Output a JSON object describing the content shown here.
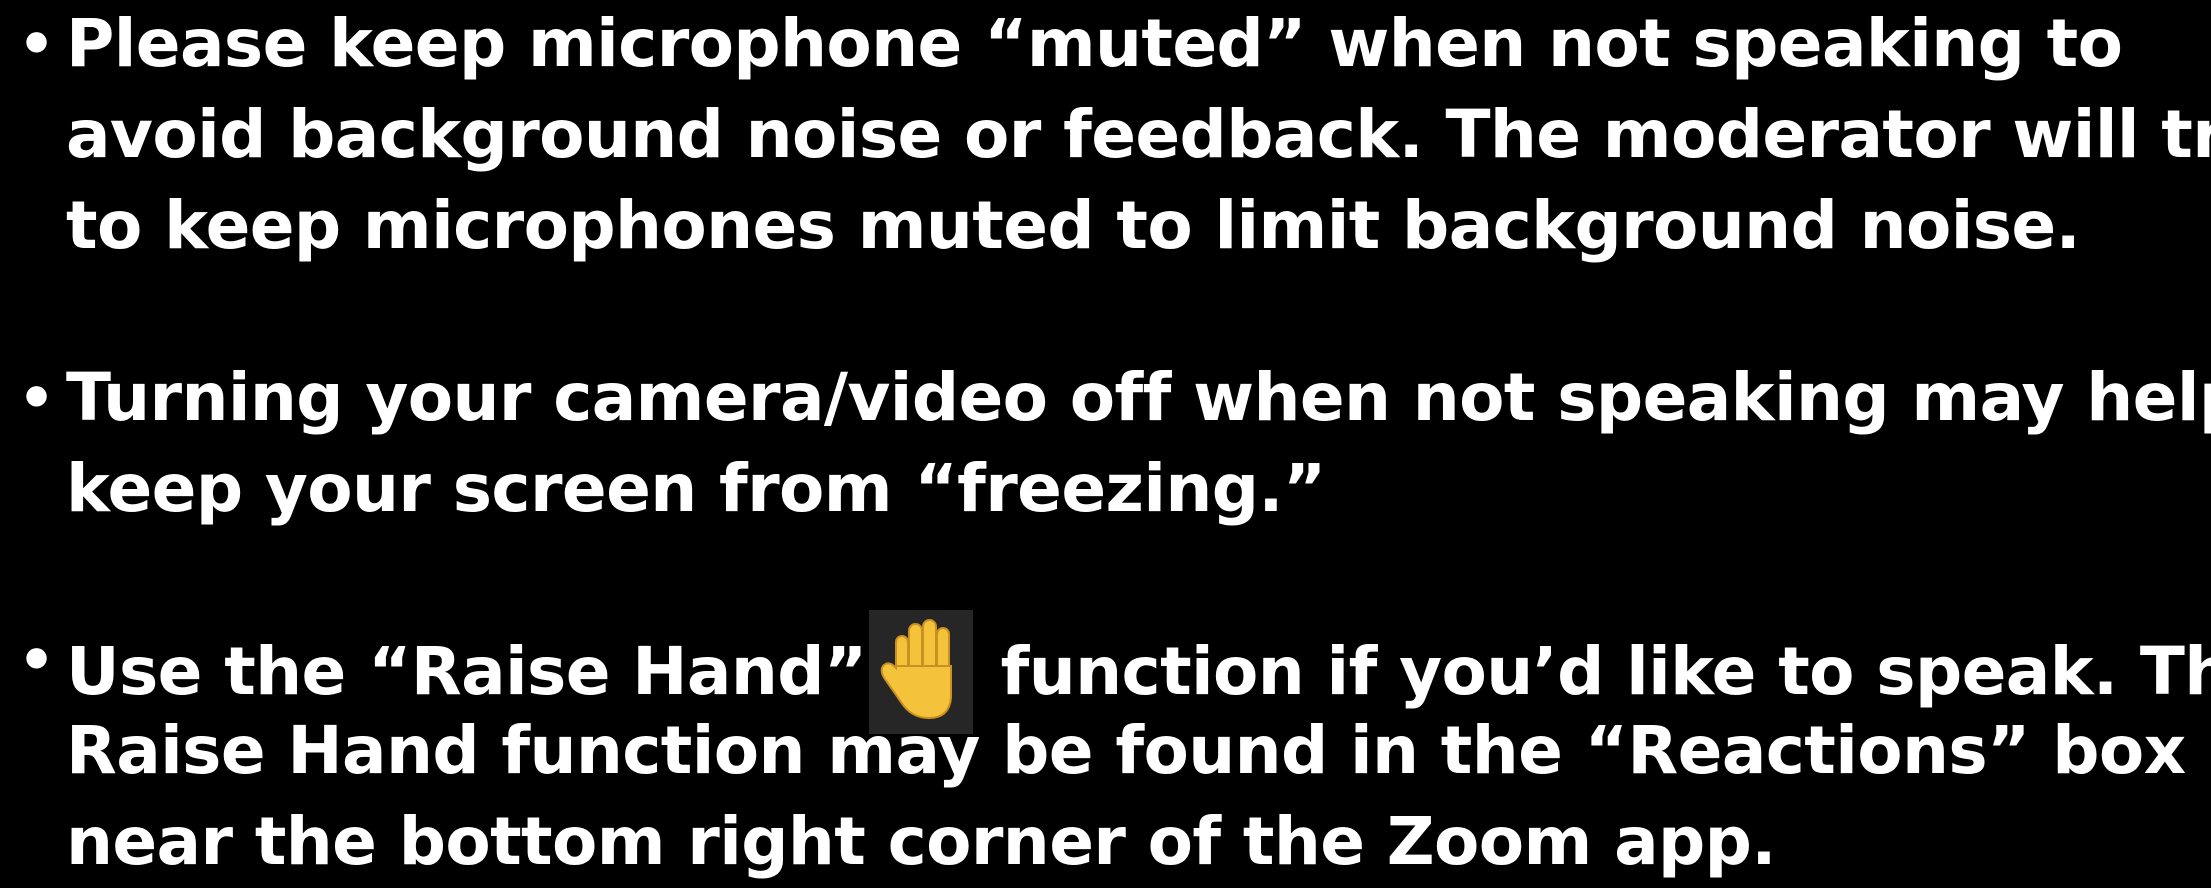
{
  "slide": {
    "background": "#000000",
    "text_color": "#ffffff",
    "bullet_glyph": "•",
    "bullets": [
      {
        "lines": [
          "Please keep microphone “muted” when not speaking to",
          "avoid background noise or feedback. The moderator will try",
          "to keep microphones muted to limit background noise."
        ]
      },
      {
        "lines": [
          "Turning your camera/video off when not speaking may help",
          "keep your screen from “freezing.”"
        ]
      },
      {
        "line1_before_icon": "Use the “Raise Hand”",
        "icon": "raised-hand-icon",
        "icon_color": "#f5c33b",
        "line1_after_icon": "function if you’d like to speak. The",
        "lines_rest": [
          "Raise Hand function may be found in the “Reactions” box",
          "near the bottom right corner of the Zoom app."
        ]
      }
    ]
  }
}
